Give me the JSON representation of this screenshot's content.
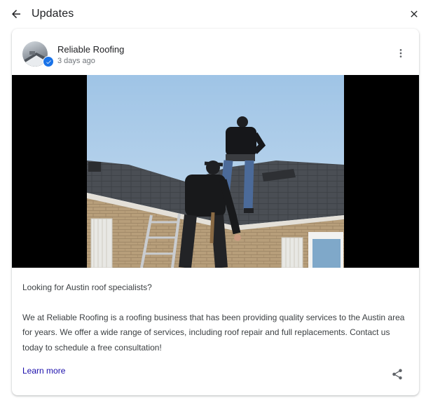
{
  "header": {
    "title": "Updates",
    "back_icon": "arrow-left-icon",
    "close_icon": "close-icon"
  },
  "post": {
    "business_name": "Reliable Roofing",
    "time_ago": "3 days ago",
    "verified_icon": "verified-check-icon",
    "more_icon": "more-vert-icon",
    "image_alt": "Two roofers climbing onto a house roof with a ladder",
    "headline": "Looking for Austin roof specialists?",
    "body": "We at Reliable Roofing is a roofing business that has been providing quality services to the Austin area for years. We offer a wide range of services, including roof repair and full replacements. Contact us today to schedule a free consultation!",
    "learn_more_label": "Learn more",
    "share_icon": "share-icon"
  },
  "colors": {
    "link": "#1a0dab",
    "verified": "#1a73e8",
    "muted_text": "#70757a"
  }
}
